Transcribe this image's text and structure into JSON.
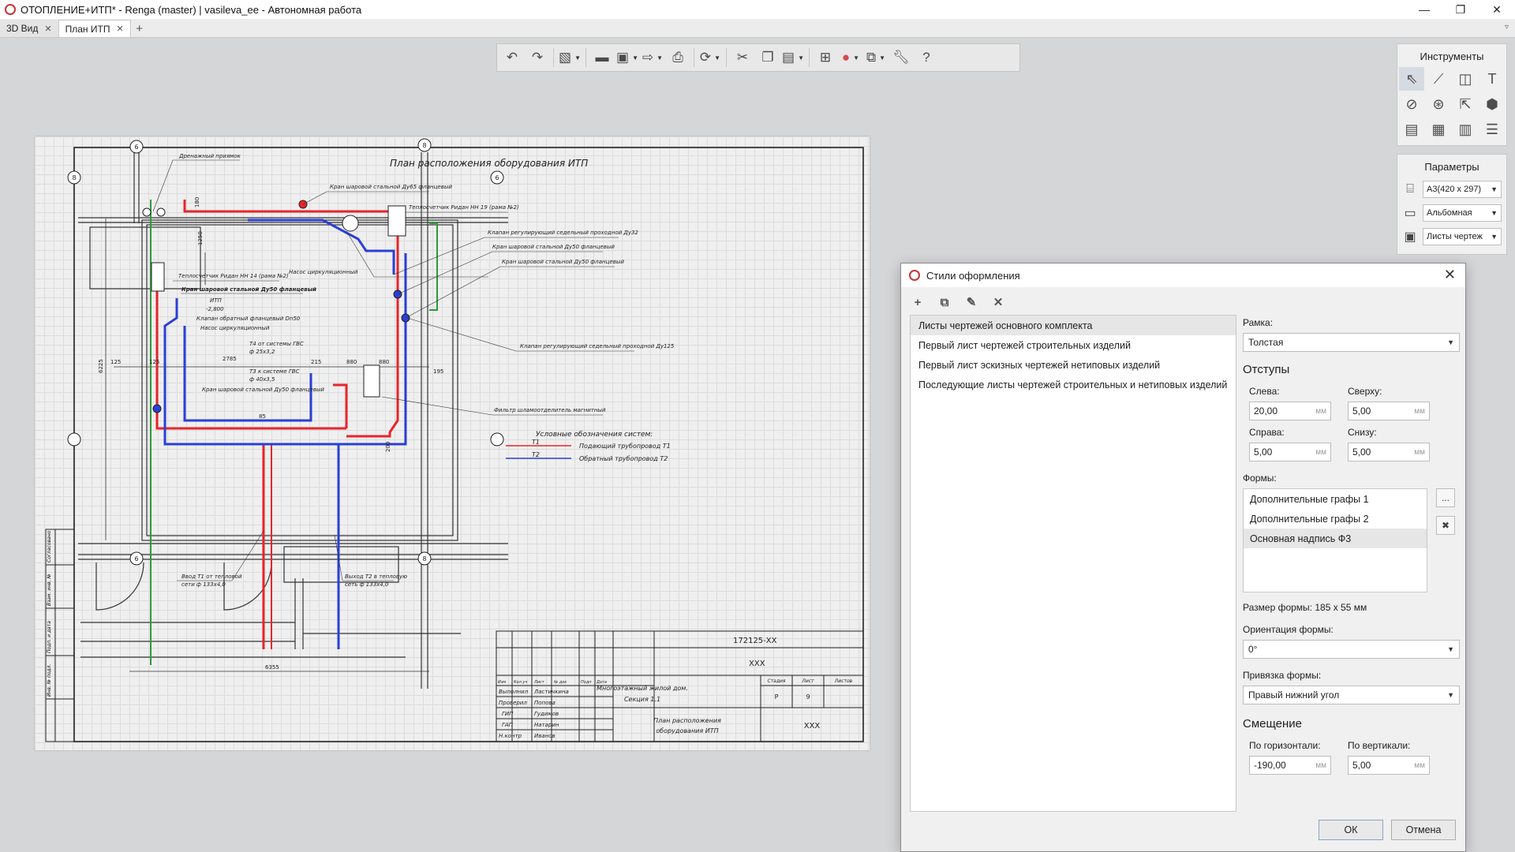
{
  "titlebar": {
    "title": "ОТОПЛЕНИЕ+ИТП* - Renga (master) | vasileva_ee - Автономная работа",
    "minimize": "—",
    "maximize": "❐",
    "close": "✕"
  },
  "tabs": [
    {
      "label": "3D Вид",
      "close": "✕"
    },
    {
      "label": "План ИТП",
      "close": "✕"
    }
  ],
  "tab_add": "+",
  "tab_overflow": "▿",
  "toolbar": {
    "icons": [
      "undo-icon",
      "redo-icon",
      "copy-properties-icon",
      "open-icon",
      "save-icon",
      "export-icon",
      "print-icon",
      "sync-icon",
      "cut-icon",
      "copy-icon",
      "paste-icon",
      "align-icon",
      "visual-style-icon",
      "views-icon",
      "settings-icon",
      "help-icon"
    ]
  },
  "tools_panel": {
    "title": "Инструменты",
    "selected": "select-tool"
  },
  "params_panel": {
    "title": "Параметры",
    "format": "А3(420 x 297)",
    "orientation": "Альбомная",
    "style": "Листы чертеж"
  },
  "drawing": {
    "title": "План расположения оборудования ИТП",
    "labels": {
      "drain": "Дренажный приямок",
      "ball65": "Кран шаровой стальной Ду65 фланцевый",
      "meter19": "Теплосчетчик Ридан НН 19 (рама №2)",
      "valve32": "Клапан регулирующий седельный проходной Ду32",
      "ball50a": "Кран шаровой стальной Ду50 фланцевый",
      "ball50b": "Кран шаровой стальной Ду50 фланцевый",
      "pump1": "Насос циркуляционный",
      "meter14": "Теплосчетчик Ридан НН 14 (рама №2)",
      "ball50c": "Кран шаровой стальной Ду50 фланцевый",
      "itp": "ИТП",
      "level": "-2,800",
      "check": "Клапан обратный фланцевый Dn50",
      "pump2": "Насос циркуляционный",
      "valve125": "Клапан регулирующий седельный проходной Ду125",
      "t4": "Т4 от системы ГВС",
      "t4d": "ф 25х3,2",
      "t3": "Т3 к системе ГВС",
      "t3d": "ф 40х3,5",
      "ball50d": "Кран шаровой стальной Ду50 фланцевый",
      "filter": "Фильтр шламоотделитель магнитный",
      "input": "Ввод Т1 от тепловой",
      "input2": "сети ф 133х4,0",
      "output": "Выход Т2 в тепловую",
      "output2": "сеть ф 133х4,0"
    },
    "dims": {
      "d1": "6225",
      "d2": "125",
      "d3": "125",
      "d4": "2785",
      "d5": "215",
      "d6": "880",
      "d7": "880",
      "d8": "195",
      "d9": "6355",
      "d10": "1250",
      "d11": "180",
      "d12": "200",
      "d13": "85"
    },
    "axes": [
      "6",
      "8",
      "8",
      "6",
      "6",
      "8"
    ],
    "legend": {
      "title": "Условные обозначения систем:",
      "items": [
        {
          "code": "Т1",
          "name": "Подающий трубопровод Т1",
          "color": "#e8252a"
        },
        {
          "code": "Т2",
          "name": "Обратный трубопровод Т2",
          "color": "#2a3fd6"
        }
      ]
    },
    "stamp": {
      "code": "172125-ХХ",
      "name1": "ХХХ",
      "building": "Многоэтажный жилой дом.",
      "section": "Секция 1.1",
      "sheet_name1": "План расположения",
      "sheet_name2": "оборудования ИТП",
      "org": "ХХХ",
      "stage_h": "Стадия",
      "sheet_h": "Лист",
      "sheets_h": "Листов",
      "stage": "Р",
      "sheet": "9",
      "head": [
        "Изм",
        "Кол.уч",
        "Лист",
        "№ док",
        "Подп",
        "Дата"
      ],
      "roles": [
        {
          "role": "Выполнил",
          "name": "Ластичкина"
        },
        {
          "role": "Проверил",
          "name": "Попова"
        },
        {
          "role": "ГИП",
          "name": "Гудимов"
        },
        {
          "role": "ГАП",
          "name": "Натарин"
        },
        {
          "role": "Н.контр",
          "name": "Иванов"
        }
      ],
      "side": [
        "Согласовано",
        "Взам. инв. №",
        "Подп. и дата",
        "Инв. № подл."
      ]
    }
  },
  "dialog": {
    "title": "Стили оформления",
    "close": "✕",
    "tools": [
      "+",
      "⧉",
      "✎",
      "✕"
    ],
    "styles": [
      "Листы чертежей основного комплекта",
      "Первый лист чертежей строительных изделий",
      "Первый лист эскизных чертежей нетиповых изделий",
      "Последующие листы чертежей строительных и нетиповых изделий"
    ],
    "selected_style": 0,
    "frame_label": "Рамка:",
    "frame_value": "Толстая",
    "margins_title": "Отступы",
    "left_label": "Слева:",
    "left_value": "20,00",
    "top_label": "Сверху:",
    "top_value": "5,00",
    "right_label": "Справа:",
    "right_value": "5,00",
    "bottom_label": "Снизу:",
    "bottom_value": "5,00",
    "unit": "мм",
    "forms_label": "Формы:",
    "forms": [
      "Дополнительные графы 1",
      "Дополнительные графы 2",
      "Основная надпись Ф3"
    ],
    "selected_form": 2,
    "forms_more": "...",
    "forms_remove": "✖",
    "form_size": "Размер формы: 185 х 55 мм",
    "orient_label": "Ориентация формы:",
    "orient_value": "0°",
    "anchor_label": "Привязка формы:",
    "anchor_value": "Правый нижний угол",
    "offset_title": "Смещение",
    "horiz_label": "По горизонтали:",
    "horiz_value": "-190,00",
    "vert_label": "По вертикали:",
    "vert_value": "5,00",
    "ok": "ОК",
    "cancel": "Отмена"
  }
}
